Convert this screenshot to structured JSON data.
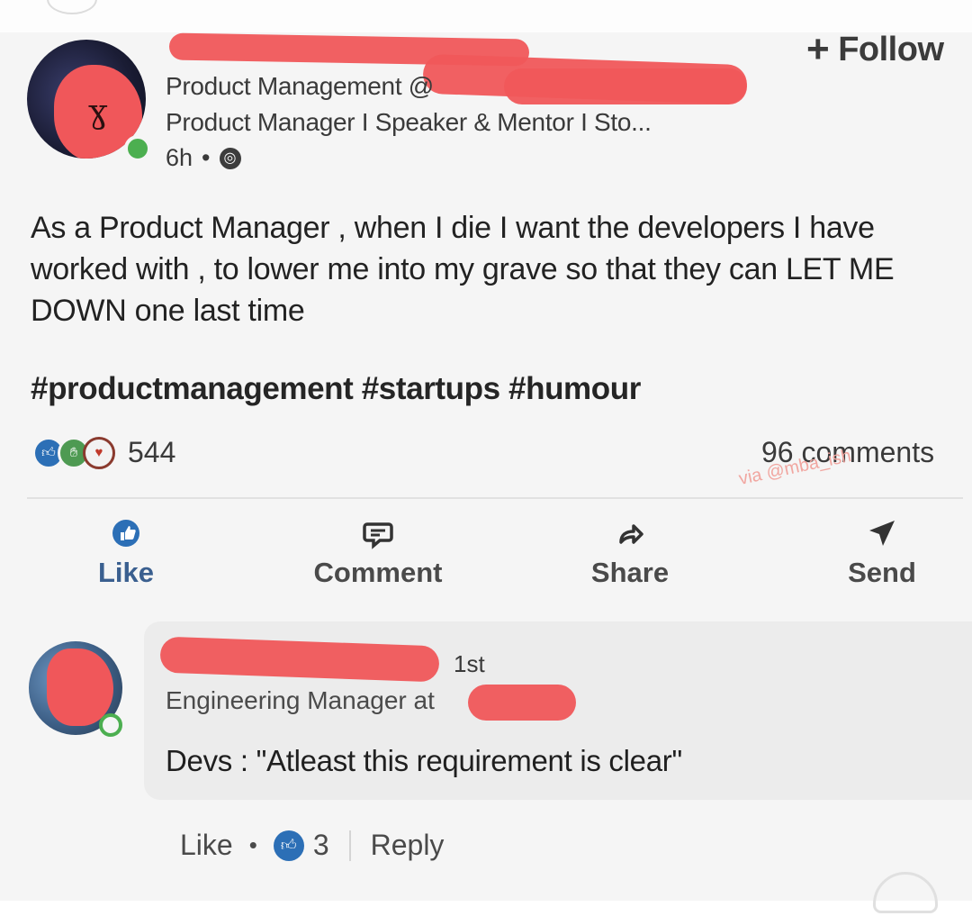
{
  "post": {
    "author_line": "Product Management @",
    "headline": "Product Manager I Speaker & Mentor I Sto...",
    "time": "6h",
    "visibility_icon": "globe-icon",
    "follow_label": "Follow",
    "body": "As a Product Manager , when I die I want the developers I have worked with , to lower me into my grave so that they can LET ME DOWN one last time",
    "hashtags": "#productmanagement #startups #humour",
    "reaction_icons": [
      "like-icon",
      "celebrate-icon",
      "love-icon"
    ],
    "reaction_count": "544",
    "comments_count": "96 comments",
    "watermark": "via @mba_ish"
  },
  "actions": {
    "like": "Like",
    "comment": "Comment",
    "share": "Share",
    "send": "Send"
  },
  "comment": {
    "degree": "1st",
    "headline": "Engineering Manager at",
    "text": "Devs : \"Atleast this requirement is clear\"",
    "like_label": "Like",
    "like_count": "3",
    "reply_label": "Reply"
  },
  "colors": {
    "redaction": "#f0575a",
    "like_blue": "#2c6fb6",
    "online_green": "#4caf50"
  }
}
